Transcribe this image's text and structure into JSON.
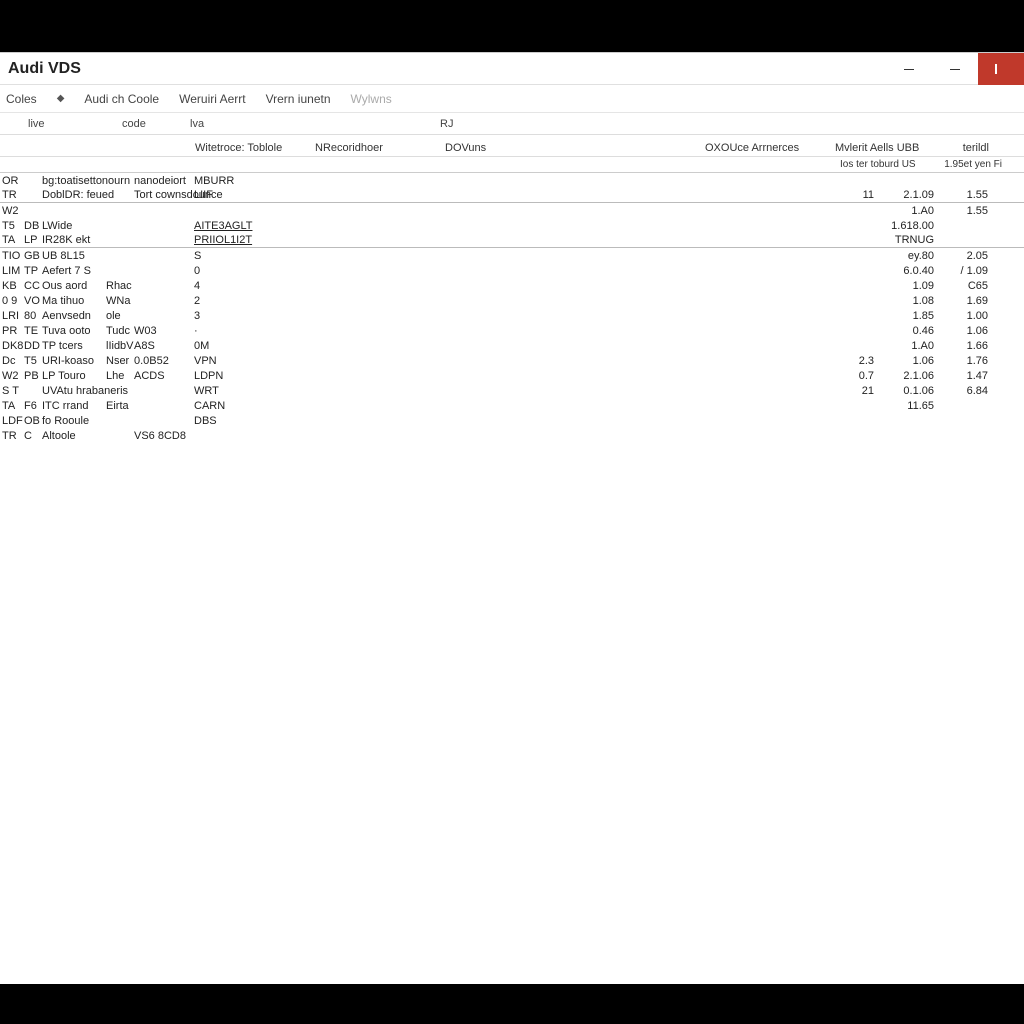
{
  "window": {
    "title": "Audi VDS"
  },
  "menubar": {
    "items": [
      {
        "label": "Coles",
        "disabled": false
      },
      {
        "label": "Audi ch Coole",
        "disabled": false
      },
      {
        "label": "Weruiri Aerrt",
        "disabled": false
      },
      {
        "label": "Vrern iunetn",
        "disabled": false
      },
      {
        "label": "Wylwns",
        "disabled": true
      }
    ]
  },
  "columns": {
    "c1": "live",
    "c2": "code",
    "c3": "lva",
    "c4": "RJ"
  },
  "subheader": {
    "s1": "Witetroce: Toblole",
    "s2": "NRecoridhoer",
    "s3": "DOVuns",
    "s4": "OXOUce Arrnerces",
    "s5": "Mvlerit Aells UBB",
    "s6": "terildl"
  },
  "subheader2": {
    "a": "Ios ter toburd US",
    "b": "1.95et yen Fi"
  },
  "rows": [
    {
      "c0": "OR",
      "c1": "",
      "c2": "bg:toatisettonourn",
      "c3": "",
      "c4": "nanodeiort",
      "c5": "MBURR",
      "c6": "",
      "c7": "",
      "c8": "",
      "ul": false
    },
    {
      "c0": "TR",
      "c1": "",
      "c2": "DoblDR: feued",
      "c3": "",
      "c4": "Tort cownsdounce",
      "c5": "LIIF",
      "c6": "11",
      "c7": "2.1.09",
      "c8": "1.55",
      "ul": true
    },
    {
      "c0": "W2",
      "c1": "",
      "c2": "",
      "c3": "",
      "c4": "",
      "c5": "",
      "c6": "",
      "c7": "1.A0",
      "c8": "1.55",
      "ul": false
    },
    {
      "c0": "T5",
      "c1": "DB",
      "c2": "LWide",
      "c3": "",
      "c4": "",
      "c5": "AITE3AGLT",
      "c6": "",
      "c7": "1.618.00",
      "c8": "",
      "ul": false,
      "ul5": true
    },
    {
      "c0": "TA",
      "c1": "LP",
      "c2": "IR28K ekt",
      "c3": "",
      "c4": "",
      "c5": "PRIIOL1I2T",
      "c6": "",
      "c7": "TRNUG",
      "c8": "",
      "ul": true,
      "ul5": true
    },
    {
      "c0": "TIO",
      "c1": "GB",
      "c2": "UB 8L15",
      "c3": "",
      "c4": "",
      "c5": "S",
      "c6": "",
      "c7": "ey.80",
      "c8": "2.05",
      "ul": false
    },
    {
      "c0": "LIM",
      "c1": "TP",
      "c2": "Aefert 7 S",
      "c3": "",
      "c4": "",
      "c5": "0",
      "c6": "",
      "c7": "6.0.40",
      "c8": "/ 1.09",
      "ul": false
    },
    {
      "c0": "KB",
      "c1": "CC",
      "c2": "Ous aord",
      "c3": "Rhac",
      "c4": "",
      "c5": "4",
      "c6": "",
      "c7": "1.09",
      "c8": "C65",
      "ul": false
    },
    {
      "c0": "0 9",
      "c1": "VO",
      "c2": "Ma tihuo",
      "c3": "WNa",
      "c4": "",
      "c5": "2",
      "c6": "",
      "c7": "1.08",
      "c8": "1.69",
      "ul": false
    },
    {
      "c0": "LRI",
      "c1": "80",
      "c2": "Aenvsedn",
      "c3": "ole",
      "c4": "",
      "c5": "3",
      "c6": "",
      "c7": "1.85",
      "c8": "1.00",
      "ul": false
    },
    {
      "c0": "PR",
      "c1": "TE",
      "c2": "Tuva ooto",
      "c3": "Tudc",
      "c4": "W03",
      "c5": "·",
      "c6": "",
      "c7": "0.46",
      "c8": "1.06",
      "ul": false
    },
    {
      "c0": "DK8",
      "c1": "DD",
      "c2": "TP tcers",
      "c3": "lIidbV",
      "c4": "A8S",
      "c5": "0M",
      "c6": "",
      "c7": "1.A0",
      "c8": "1.66",
      "ul": false
    },
    {
      "c0": "Dc",
      "c1": "T5",
      "c2": "URI-koaso",
      "c3": "Nser",
      "c4": "0.0B52",
      "c5": "VPN",
      "c6": "2.3",
      "c7": "1.06",
      "c8": "1.76",
      "ul": false
    },
    {
      "c0": "W2",
      "c1": "PB",
      "c2": "LP Touro",
      "c3": "Lhe",
      "c4": "ACDS",
      "c5": "LDPN",
      "c6": "0.7",
      "c7": "2.1.06",
      "c8": "1.47",
      "ul": false
    },
    {
      "c0": "S T",
      "c1": "",
      "c2": "UVAtu hrabaneris",
      "c3": "",
      "c4": "",
      "c5": "WRT",
      "c6": "21",
      "c7": "0.1.06",
      "c8": "6.84",
      "ul": false
    },
    {
      "c0": "TA",
      "c1": "F6",
      "c2": "ITC rrand",
      "c3": "Eirta",
      "c4": "",
      "c5": "CARN",
      "c6": "",
      "c7": "11.65",
      "c8": "",
      "ul": false
    },
    {
      "c0": "LDF",
      "c1": "OB",
      "c2": "fo Rooule",
      "c3": "",
      "c4": "",
      "c5": "DBS",
      "c6": "",
      "c7": "",
      "c8": "",
      "ul": false
    },
    {
      "c0": "TR",
      "c1": "C",
      "c2": "Altoole",
      "c3": "",
      "c4": "VS6 8CD8",
      "c5": "",
      "c6": "",
      "c7": "",
      "c8": "",
      "ul": false
    }
  ]
}
